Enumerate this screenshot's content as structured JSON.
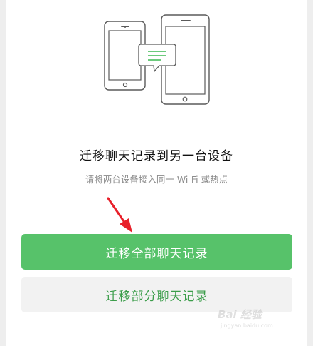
{
  "main": {
    "title": "迁移聊天记录到另一台设备",
    "subtitle": "请将两台设备接入同一 Wi-Fi 或热点"
  },
  "actions": {
    "migrate_all_label": "迁移全部聊天记录",
    "migrate_partial_label": "迁移部分聊天记录"
  },
  "watermark": {
    "logo_text": "Bai 经验",
    "url_text": "jingyan.baidu.com"
  },
  "icons": {
    "illustration": "two-phones-transfer-illustration",
    "arrow": "red-pointer-arrow-icon"
  },
  "colors": {
    "primary": "#57c26a",
    "secondary_text": "#3b9d4a",
    "arrow": "#e8202a"
  }
}
